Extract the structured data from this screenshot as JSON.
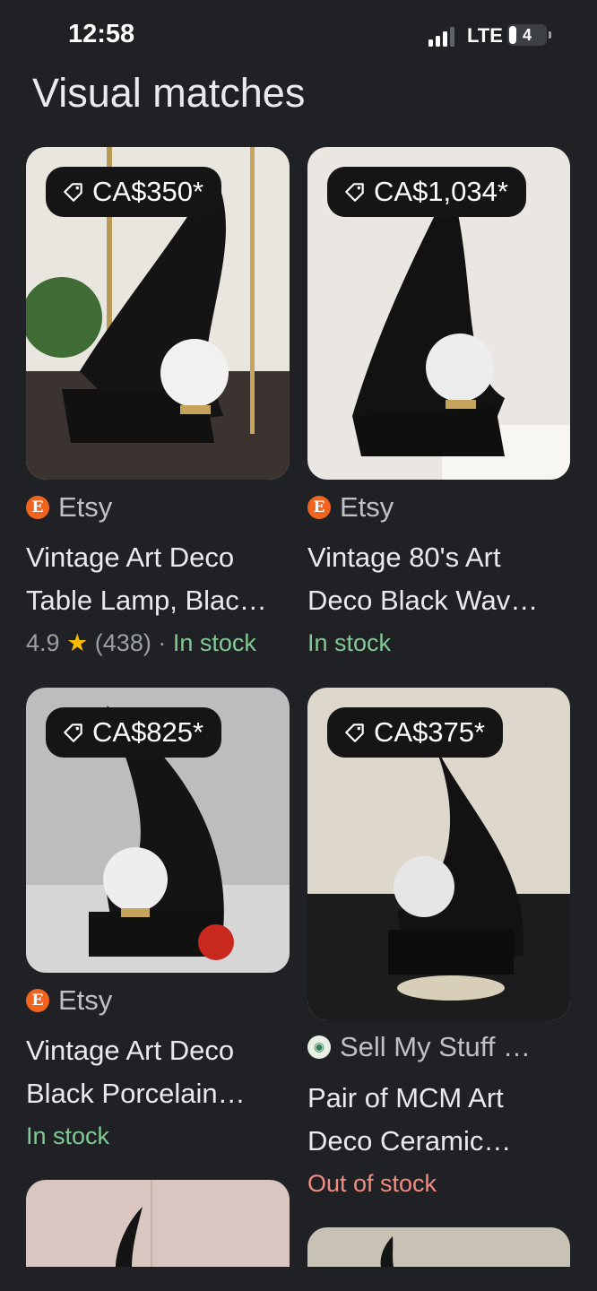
{
  "status_bar": {
    "time": "12:58",
    "network": "LTE",
    "battery": "4"
  },
  "page": {
    "heading": "Visual matches"
  },
  "icons": {
    "price": "tag-icon",
    "etsy": "etsy-logo-icon",
    "sellmystuff": "sellmystuff-logo-icon"
  },
  "colors": {
    "in_stock": "#81c995",
    "out_of_stock": "#f28b82",
    "star": "#fbbc04",
    "etsy": "#f1641e"
  },
  "results": [
    {
      "price": "CA$350*",
      "source": "Etsy",
      "title_line1": "Vintage Art Deco",
      "title_line2": "Table Lamp, Blac…",
      "rating": "4.9",
      "star": "★",
      "reviews": "(438)",
      "separator": "·",
      "availability": "In stock"
    },
    {
      "price": "CA$1,034*",
      "source": "Etsy",
      "title_line1": "Vintage 80's Art",
      "title_line2": "Deco Black Wav…",
      "availability": "In stock"
    },
    {
      "price": "CA$825*",
      "source": "Etsy",
      "title_line1": "Vintage Art Deco",
      "title_line2": "Black Porcelain…",
      "availability": "In stock"
    },
    {
      "price": "CA$375*",
      "source": "Sell My Stuff …",
      "title_line1": "Pair of MCM Art",
      "title_line2": "Deco Ceramic…",
      "availability": "Out of stock"
    }
  ]
}
